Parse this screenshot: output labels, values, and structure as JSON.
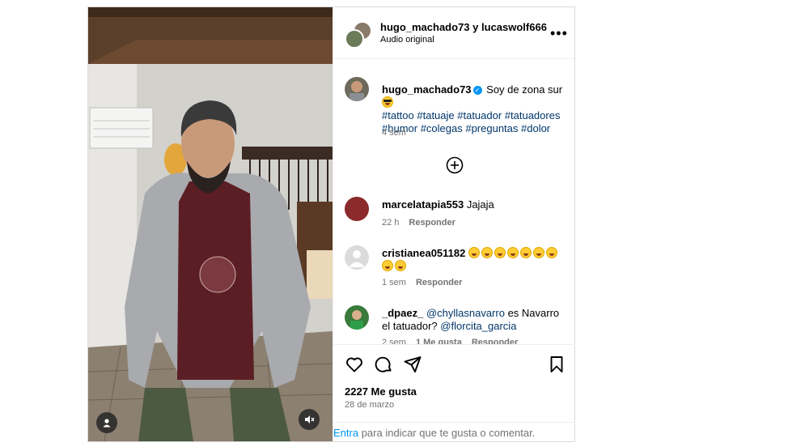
{
  "header": {
    "user_a": "hugo_machado73",
    "joiner": "y",
    "user_b": "lucaswolf666",
    "audio": "Audio original",
    "more_icon": "more-options-icon"
  },
  "caption": {
    "username": "hugo_machado73",
    "text": "Soy de zona sur",
    "hashtags_line1": "#tattoo #tatuaje #tatuador #tatuadores",
    "hashtags_line2": "#humor #colegas #preguntas #dolor",
    "time": "4 sem"
  },
  "comments": [
    {
      "username": "marcelatapia553",
      "text": "Jajaja",
      "time": "22 h",
      "reply": "Responder"
    },
    {
      "username": "cristianea051182",
      "text": "",
      "time": "1 sem",
      "reply": "Responder"
    },
    {
      "username": "_dpaez_",
      "mention1": "@chyllasnavarro",
      "text": "es Navarro el tatuador?",
      "mention2": "@florcita_garcia",
      "time": "2 sem",
      "likes": "1 Me gusta",
      "reply": "Responder"
    }
  ],
  "actions": {
    "likes": "2227 Me gusta",
    "date": "28 de marzo"
  },
  "footer": {
    "link": "Entra",
    "text": "para indicar que te gusta o comentar."
  },
  "colors": {
    "link": "#00376b",
    "accent": "#0095f6",
    "muted": "#737373",
    "border": "#dbdbdb"
  }
}
